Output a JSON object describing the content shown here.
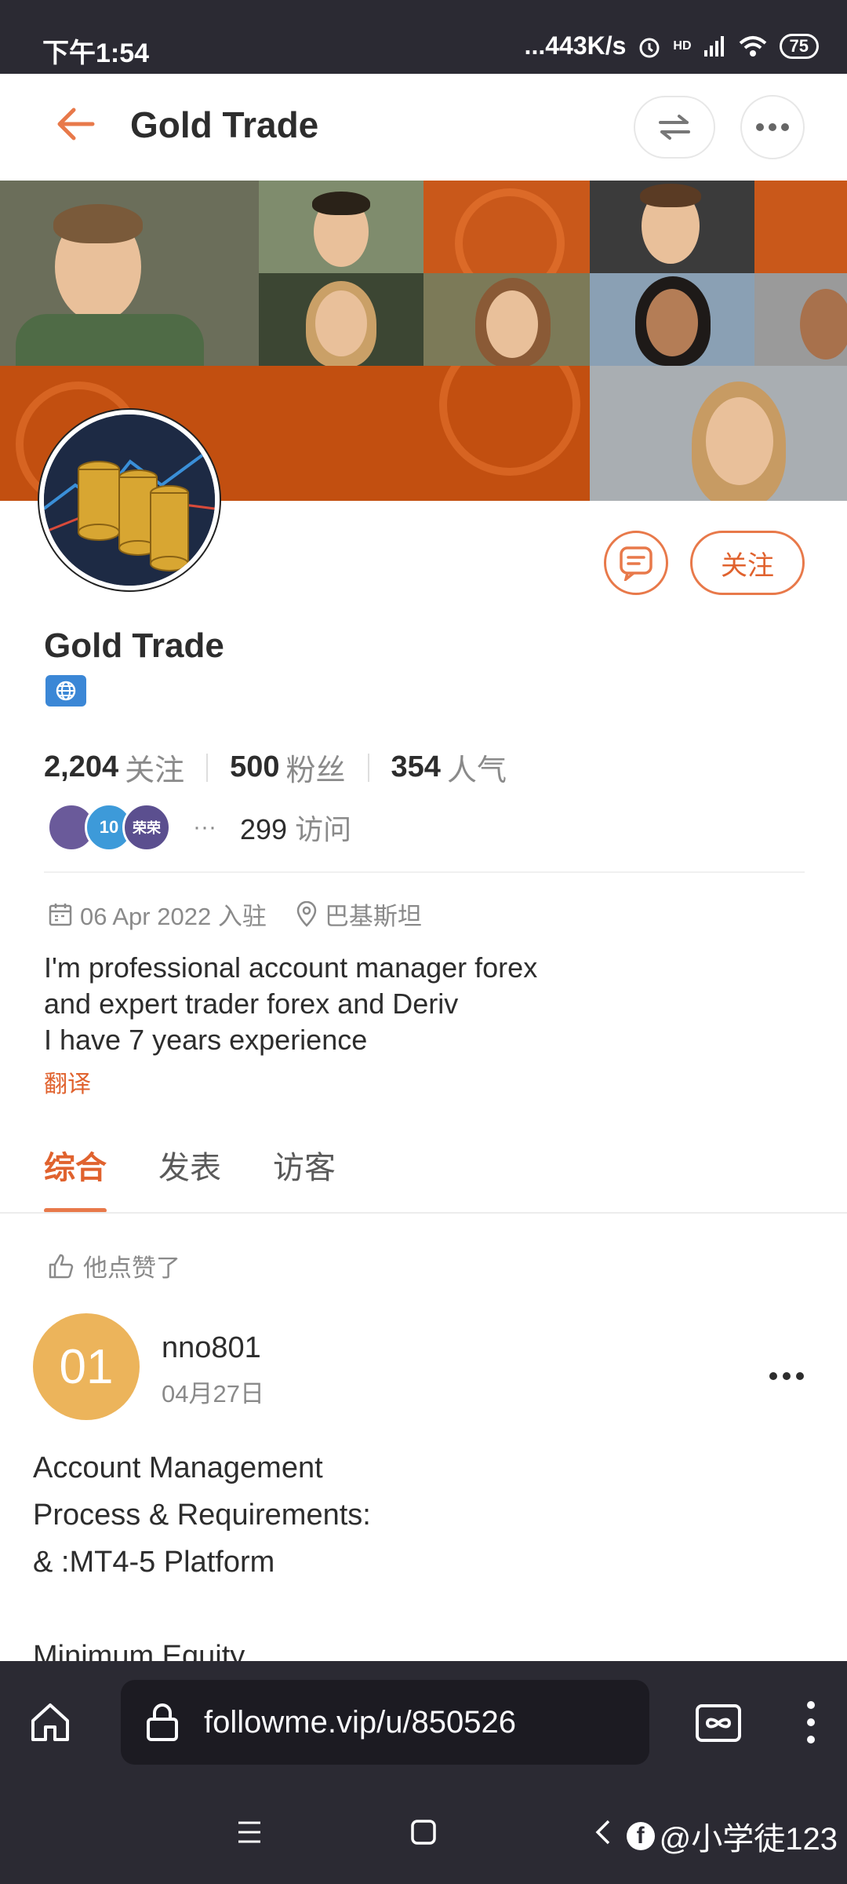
{
  "status_bar": {
    "time": "下午1:54",
    "network_speed": "...443K/s",
    "hd_label": "HD",
    "battery": "75"
  },
  "header": {
    "title": "Gold Trade"
  },
  "profile": {
    "name": "Gold Trade",
    "follow_label": "关注",
    "stats": {
      "following_count": "2,204",
      "following_label": "关注",
      "followers_count": "500",
      "followers_label": "粉丝",
      "popularity_count": "354",
      "popularity_label": "人气"
    },
    "visitor_avatars": [
      "",
      "10",
      "荣荣"
    ],
    "visitor_ellipsis": "···",
    "visits_count": "299",
    "visits_label": "访问",
    "join_date": "06 Apr 2022 入驻",
    "location": "巴基斯坦",
    "bio_lines": [
      "I'm professional account manager forex",
      "and expert trader forex and Deriv",
      "I have 7 years experience"
    ],
    "translate_label": "翻译"
  },
  "tabs": [
    {
      "label": "综合",
      "active": true
    },
    {
      "label": "发表",
      "active": false
    },
    {
      "label": "访客",
      "active": false
    }
  ],
  "feed": {
    "liked_label": "他点赞了",
    "post": {
      "avatar_text": "01",
      "username": "nno801",
      "date": "04月27日",
      "body_lines": [
        "Account Management",
        "Process & Requirements:",
        "& :MT4-5 Platform",
        "",
        "Minimum Equity"
      ]
    }
  },
  "browser": {
    "url": "followme.vip/u/850526"
  },
  "watermark": "@小学徒123",
  "colors": {
    "accent": "#e8794a",
    "banner_orange": "#c24f10",
    "system_bar": "#2b2a33",
    "post_avatar": "#ecb45b"
  }
}
